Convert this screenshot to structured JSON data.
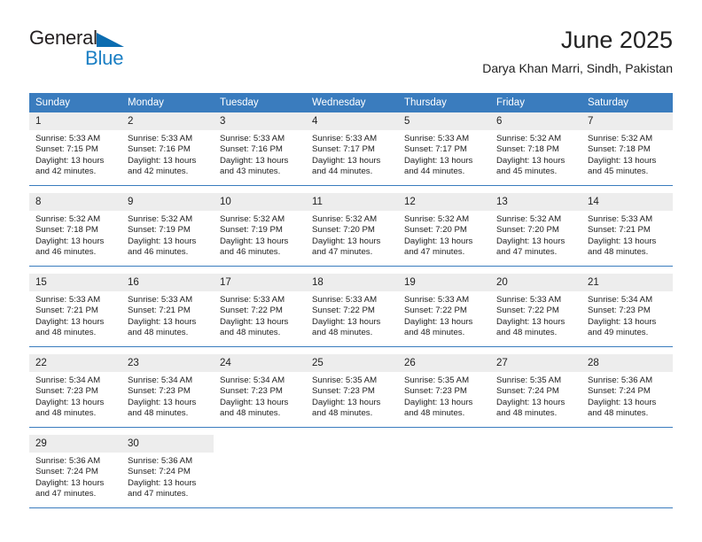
{
  "brand": {
    "name_top": "General",
    "name_bottom": "Blue",
    "triangle_color": "#0b6cb0",
    "top_color": "#231f20",
    "bottom_color": "#1b7fc4"
  },
  "header": {
    "title": "June 2025",
    "subtitle": "Darya Khan Marri, Sindh, Pakistan"
  },
  "colors": {
    "header_band": "#3a7cbe",
    "daynum_strip": "#ededed",
    "row_divider": "#3a7cbe",
    "text": "#222222"
  },
  "weekday_headers": [
    "Sunday",
    "Monday",
    "Tuesday",
    "Wednesday",
    "Thursday",
    "Friday",
    "Saturday"
  ],
  "weeks": [
    [
      {
        "day": "1",
        "sunrise": "Sunrise: 5:33 AM",
        "sunset": "Sunset: 7:15 PM",
        "daylight_line1": "Daylight: 13 hours",
        "daylight_line2": "and 42 minutes."
      },
      {
        "day": "2",
        "sunrise": "Sunrise: 5:33 AM",
        "sunset": "Sunset: 7:16 PM",
        "daylight_line1": "Daylight: 13 hours",
        "daylight_line2": "and 42 minutes."
      },
      {
        "day": "3",
        "sunrise": "Sunrise: 5:33 AM",
        "sunset": "Sunset: 7:16 PM",
        "daylight_line1": "Daylight: 13 hours",
        "daylight_line2": "and 43 minutes."
      },
      {
        "day": "4",
        "sunrise": "Sunrise: 5:33 AM",
        "sunset": "Sunset: 7:17 PM",
        "daylight_line1": "Daylight: 13 hours",
        "daylight_line2": "and 44 minutes."
      },
      {
        "day": "5",
        "sunrise": "Sunrise: 5:33 AM",
        "sunset": "Sunset: 7:17 PM",
        "daylight_line1": "Daylight: 13 hours",
        "daylight_line2": "and 44 minutes."
      },
      {
        "day": "6",
        "sunrise": "Sunrise: 5:32 AM",
        "sunset": "Sunset: 7:18 PM",
        "daylight_line1": "Daylight: 13 hours",
        "daylight_line2": "and 45 minutes."
      },
      {
        "day": "7",
        "sunrise": "Sunrise: 5:32 AM",
        "sunset": "Sunset: 7:18 PM",
        "daylight_line1": "Daylight: 13 hours",
        "daylight_line2": "and 45 minutes."
      }
    ],
    [
      {
        "day": "8",
        "sunrise": "Sunrise: 5:32 AM",
        "sunset": "Sunset: 7:18 PM",
        "daylight_line1": "Daylight: 13 hours",
        "daylight_line2": "and 46 minutes."
      },
      {
        "day": "9",
        "sunrise": "Sunrise: 5:32 AM",
        "sunset": "Sunset: 7:19 PM",
        "daylight_line1": "Daylight: 13 hours",
        "daylight_line2": "and 46 minutes."
      },
      {
        "day": "10",
        "sunrise": "Sunrise: 5:32 AM",
        "sunset": "Sunset: 7:19 PM",
        "daylight_line1": "Daylight: 13 hours",
        "daylight_line2": "and 46 minutes."
      },
      {
        "day": "11",
        "sunrise": "Sunrise: 5:32 AM",
        "sunset": "Sunset: 7:20 PM",
        "daylight_line1": "Daylight: 13 hours",
        "daylight_line2": "and 47 minutes."
      },
      {
        "day": "12",
        "sunrise": "Sunrise: 5:32 AM",
        "sunset": "Sunset: 7:20 PM",
        "daylight_line1": "Daylight: 13 hours",
        "daylight_line2": "and 47 minutes."
      },
      {
        "day": "13",
        "sunrise": "Sunrise: 5:32 AM",
        "sunset": "Sunset: 7:20 PM",
        "daylight_line1": "Daylight: 13 hours",
        "daylight_line2": "and 47 minutes."
      },
      {
        "day": "14",
        "sunrise": "Sunrise: 5:33 AM",
        "sunset": "Sunset: 7:21 PM",
        "daylight_line1": "Daylight: 13 hours",
        "daylight_line2": "and 48 minutes."
      }
    ],
    [
      {
        "day": "15",
        "sunrise": "Sunrise: 5:33 AM",
        "sunset": "Sunset: 7:21 PM",
        "daylight_line1": "Daylight: 13 hours",
        "daylight_line2": "and 48 minutes."
      },
      {
        "day": "16",
        "sunrise": "Sunrise: 5:33 AM",
        "sunset": "Sunset: 7:21 PM",
        "daylight_line1": "Daylight: 13 hours",
        "daylight_line2": "and 48 minutes."
      },
      {
        "day": "17",
        "sunrise": "Sunrise: 5:33 AM",
        "sunset": "Sunset: 7:22 PM",
        "daylight_line1": "Daylight: 13 hours",
        "daylight_line2": "and 48 minutes."
      },
      {
        "day": "18",
        "sunrise": "Sunrise: 5:33 AM",
        "sunset": "Sunset: 7:22 PM",
        "daylight_line1": "Daylight: 13 hours",
        "daylight_line2": "and 48 minutes."
      },
      {
        "day": "19",
        "sunrise": "Sunrise: 5:33 AM",
        "sunset": "Sunset: 7:22 PM",
        "daylight_line1": "Daylight: 13 hours",
        "daylight_line2": "and 48 minutes."
      },
      {
        "day": "20",
        "sunrise": "Sunrise: 5:33 AM",
        "sunset": "Sunset: 7:22 PM",
        "daylight_line1": "Daylight: 13 hours",
        "daylight_line2": "and 48 minutes."
      },
      {
        "day": "21",
        "sunrise": "Sunrise: 5:34 AM",
        "sunset": "Sunset: 7:23 PM",
        "daylight_line1": "Daylight: 13 hours",
        "daylight_line2": "and 49 minutes."
      }
    ],
    [
      {
        "day": "22",
        "sunrise": "Sunrise: 5:34 AM",
        "sunset": "Sunset: 7:23 PM",
        "daylight_line1": "Daylight: 13 hours",
        "daylight_line2": "and 48 minutes."
      },
      {
        "day": "23",
        "sunrise": "Sunrise: 5:34 AM",
        "sunset": "Sunset: 7:23 PM",
        "daylight_line1": "Daylight: 13 hours",
        "daylight_line2": "and 48 minutes."
      },
      {
        "day": "24",
        "sunrise": "Sunrise: 5:34 AM",
        "sunset": "Sunset: 7:23 PM",
        "daylight_line1": "Daylight: 13 hours",
        "daylight_line2": "and 48 minutes."
      },
      {
        "day": "25",
        "sunrise": "Sunrise: 5:35 AM",
        "sunset": "Sunset: 7:23 PM",
        "daylight_line1": "Daylight: 13 hours",
        "daylight_line2": "and 48 minutes."
      },
      {
        "day": "26",
        "sunrise": "Sunrise: 5:35 AM",
        "sunset": "Sunset: 7:23 PM",
        "daylight_line1": "Daylight: 13 hours",
        "daylight_line2": "and 48 minutes."
      },
      {
        "day": "27",
        "sunrise": "Sunrise: 5:35 AM",
        "sunset": "Sunset: 7:24 PM",
        "daylight_line1": "Daylight: 13 hours",
        "daylight_line2": "and 48 minutes."
      },
      {
        "day": "28",
        "sunrise": "Sunrise: 5:36 AM",
        "sunset": "Sunset: 7:24 PM",
        "daylight_line1": "Daylight: 13 hours",
        "daylight_line2": "and 48 minutes."
      }
    ],
    [
      {
        "day": "29",
        "sunrise": "Sunrise: 5:36 AM",
        "sunset": "Sunset: 7:24 PM",
        "daylight_line1": "Daylight: 13 hours",
        "daylight_line2": "and 47 minutes."
      },
      {
        "day": "30",
        "sunrise": "Sunrise: 5:36 AM",
        "sunset": "Sunset: 7:24 PM",
        "daylight_line1": "Daylight: 13 hours",
        "daylight_line2": "and 47 minutes."
      },
      {
        "day": "",
        "sunrise": "",
        "sunset": "",
        "daylight_line1": "",
        "daylight_line2": ""
      },
      {
        "day": "",
        "sunrise": "",
        "sunset": "",
        "daylight_line1": "",
        "daylight_line2": ""
      },
      {
        "day": "",
        "sunrise": "",
        "sunset": "",
        "daylight_line1": "",
        "daylight_line2": ""
      },
      {
        "day": "",
        "sunrise": "",
        "sunset": "",
        "daylight_line1": "",
        "daylight_line2": ""
      },
      {
        "day": "",
        "sunrise": "",
        "sunset": "",
        "daylight_line1": "",
        "daylight_line2": ""
      }
    ]
  ]
}
